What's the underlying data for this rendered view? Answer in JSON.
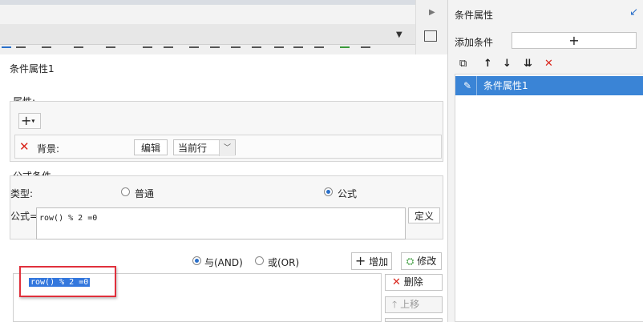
{
  "right_panel": {
    "title": "条件属性",
    "add_condition_label": "添加条件",
    "add_button_label": "+",
    "list_items": [
      {
        "label": "条件属性1"
      }
    ]
  },
  "dialog": {
    "title": "条件属性1",
    "attributes": {
      "label": "属性:",
      "add_label": "+",
      "row": {
        "name": "背景:",
        "edit_button": "编辑",
        "scope_value": "当前行"
      }
    },
    "formula_condition": {
      "label": "公式条件",
      "type_label": "类型:",
      "option_normal": "普通",
      "option_formula": "公式",
      "selected": "公式",
      "formula_label": "公式=",
      "formula_value": "row() % 2 =0",
      "define_button": "定义"
    },
    "logic": {
      "and_label": "与(AND)",
      "or_label": "或(OR)",
      "selected": "与(AND)",
      "add_button": "增加",
      "modify_button": "修改"
    },
    "conditions": [
      "row() % 2 =0"
    ],
    "delete_button": "删除",
    "move_up_button": "上移"
  },
  "colors": {
    "accent": "#3a84d6",
    "selection": "#3377dd",
    "danger": "#d9261c",
    "highlight_frame": "#e0303c"
  }
}
